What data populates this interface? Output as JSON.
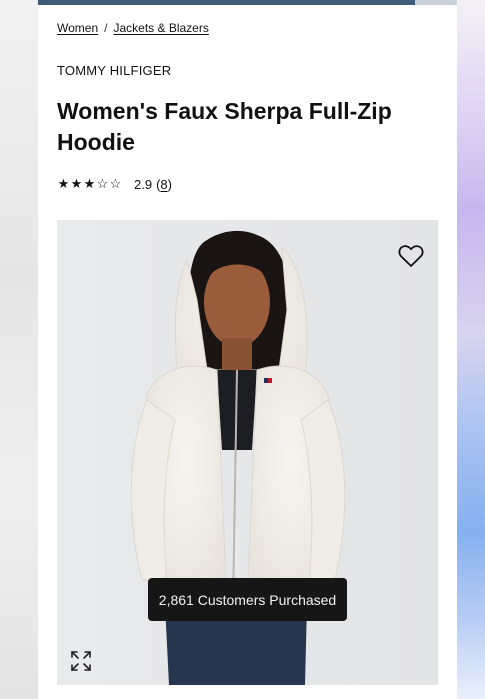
{
  "breadcrumb": {
    "items": [
      "Women",
      "Jackets & Blazers"
    ],
    "separator": "/"
  },
  "product": {
    "brand": "TOMMY HILFIGER",
    "title": "Women's Faux Sherpa Full-Zip Hoodie",
    "rating": {
      "stars": [
        "★",
        "★",
        "★",
        "☆",
        "☆"
      ],
      "value": 2.9,
      "score_text": "2.9",
      "count_open": "(",
      "count_text": "8",
      "count_close": ")"
    }
  },
  "media": {
    "purchased_badge": "2,861 Customers Purchased",
    "wishlist_icon": "heart-outline-icon",
    "expand_icon": "expand-arrows-icon"
  },
  "colors": {
    "top_bar": "#3f5c7a",
    "badge_bg": "#161616",
    "image_bg": "#e7e8ea"
  }
}
